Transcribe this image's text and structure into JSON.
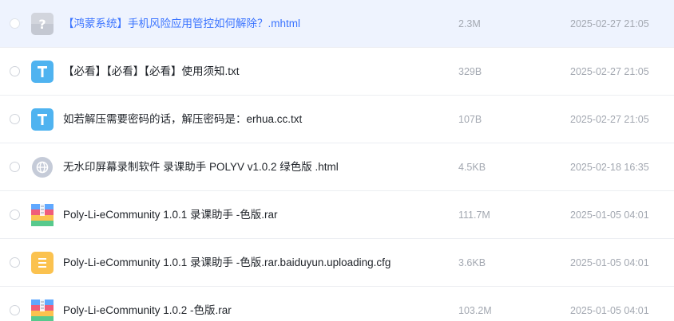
{
  "files": [
    {
      "name": "【鸿蒙系统】手机风险应用管控如何解除？.mhtml",
      "size": "2.3M",
      "date": "2025-02-27 21:05",
      "icon": "unknown-file-icon",
      "selected": true
    },
    {
      "name": "【必看】【必看】【必看】使用须知.txt",
      "size": "329B",
      "date": "2025-02-27 21:05",
      "icon": "txt-file-icon",
      "selected": false
    },
    {
      "name": "如若解压需要密码的话，解压密码是：erhua.cc.txt",
      "size": "107B",
      "date": "2025-02-27 21:05",
      "icon": "txt-file-icon",
      "selected": false
    },
    {
      "name": "无水印屏幕录制软件 录课助手 POLYV v1.0.2 绿色版 .html",
      "size": "4.5KB",
      "date": "2025-02-18 16:35",
      "icon": "web-file-icon",
      "selected": false
    },
    {
      "name": "Poly-Li-eCommunity 1.0.1 录课助手 -色版.rar",
      "size": "111.7M",
      "date": "2025-01-05 04:01",
      "icon": "archive-file-icon",
      "selected": false
    },
    {
      "name": "Poly-Li-eCommunity 1.0.1 录课助手 -色版.rar.baiduyun.uploading.cfg",
      "size": "3.6KB",
      "date": "2025-01-05 04:01",
      "icon": "document-file-icon",
      "selected": false
    },
    {
      "name": "Poly-Li-eCommunity 1.0.2 -色版.rar",
      "size": "103.2M",
      "date": "2025-01-05 04:01",
      "icon": "archive-file-icon",
      "selected": false
    }
  ],
  "colors": {
    "selected_row_bg": "#eef3fe",
    "selected_text": "#3b74ff",
    "txt_icon": "#4fb3f0",
    "doc_icon": "#fbc24f",
    "unknown_icon": "#c4c8d2",
    "web_icon": "#c5cbd8"
  }
}
